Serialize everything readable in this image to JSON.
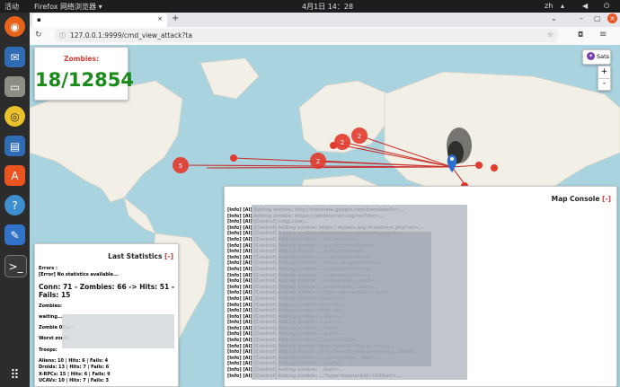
{
  "ubuntu": {
    "activities": "活动",
    "app_name": "Firefox 网络浏览器",
    "clock": "4月1日 14：28",
    "lang": "zh"
  },
  "browser": {
    "tab_title": "",
    "url": "127.0.0.1:9999/cmd_view_attack?ta"
  },
  "map_controls": {
    "sats_label": "Sats",
    "zoom_in": "+",
    "zoom_out": "-"
  },
  "zombies_panel": {
    "title": "Zombies:",
    "count": "18/12854"
  },
  "console": {
    "title": "Map Console",
    "close": "[-]",
    "lines": [
      "[Info] [AI] Adding zombie: http://translate.google.com/translate?u=...",
      "[Info] [AI] Adding zombie: https://validator.w3.org/nu/?doc=...",
      "[Info] [AI] [Control] cztgj.com/...",
      "[Info] [AI] [Control] Adding zombie: https://myleks.wip.tt/redirect.php?url=...",
      "[Info] [AI] [Control] Adding zombie: http://istimaengenharia.com.br...",
      "[Info] [AI] [Control] Adding zombie: ...ort.me/?url=...",
      "[Info] [AI] [Control] Adding zombie: ...e.com/tools/webhit/...",
      "[Info] [AI] [Control] Adding zombie: ...apiclickthrough.",
      "[Info] [AI] [Control] Adding zombie: ...o.uk/apiclickthrou",
      "[Info] [AI] [Control] Adding zombie: ...ist.co.uk/apiclickthrou",
      "[Info] [AI] [Control] Adding zombie: ...o.uk/apiclickthrou",
      "[Info] [AI] [Control] Adding zombie: ...o.uk/apiclickthrou",
      "[Info] [AI] [Control] Adding zombie: ...banner&id=...&url=...",
      "[Info] [AI] [Control] Adding zombie: ...banner&id=...&url=...",
      "[Info] [AI] [Control] Adding zombie: ...type=banner&id=...&url=...",
      "[Info] [AI] [Control] Adding zombie: http://bc...",
      "[Info] [AI] [Control] Adding zombie: http://bc...",
      "[Info] [AI] [Control] Adding zombie: http://bc...",
      "[Info] [AI] [Control] Adding zombie: ...&url=...",
      "[Info] [AI] [Control] Adding zombie: ...&url=...",
      "[Info] [AI] [Control] Adding zombie: ...&url=...",
      "[Info] [AI] [Control] Adding zombie: ...&url=...",
      "[Info] [AI] [Control] Adding zombie: ...s.gs/rank/go...",
      "[Info] [AI] [Control] Adding zombie: http://fera18.view.gs/rank/g...",
      "[Info] [AI] [Control] Adding zombie: http://fera18.view.gs/rank/go...dealhi...",
      "[Info] [AI] [Control] Adding zombie: ...s.gs/rank/go...deal=...",
      "[Info] [AI] [Control] Adding zombie: ...dealhi...",
      "[Info] [AI] [Control] Adding zombie: ...&url=...",
      "[Info] [AI] [Control] Adding zombie: ...?type=banner&id=169&url=..."
    ]
  },
  "stats": {
    "title": "Last Statistics",
    "close": "[-]",
    "errors_label": "Errors :",
    "errors_value": "[Error] No statistics available...",
    "conn_line": "Conn: 71 - Zombies: 66 -> Hits: 51 - Fails: 15",
    "zombies_label": "Zombies:",
    "waiting": "waiting...",
    "zombie_label": "Zombie 0day:",
    "worst_label": "Worst zomb",
    "troops_label": "Troops:",
    "troops": [
      "Aliens: 10 | Hits: 6 | Fails: 4",
      "Droids: 13 | Hits: 7 | Fails: 6",
      "X-RPCs: 15 | Hits: 6 | Fails: 9",
      "UCAVs: 10 | Hits: 7 | Fails: 3"
    ]
  },
  "markers": [
    {
      "label": "5"
    },
    {
      "label": "2"
    },
    {
      "label": "2"
    },
    {
      "label": "2"
    },
    {
      "label": "2"
    }
  ],
  "colors": {
    "accent_red": "#d83a34",
    "count_green": "#1a8a1a",
    "map_water": "#a9d3df",
    "map_land": "#f2efe6"
  }
}
